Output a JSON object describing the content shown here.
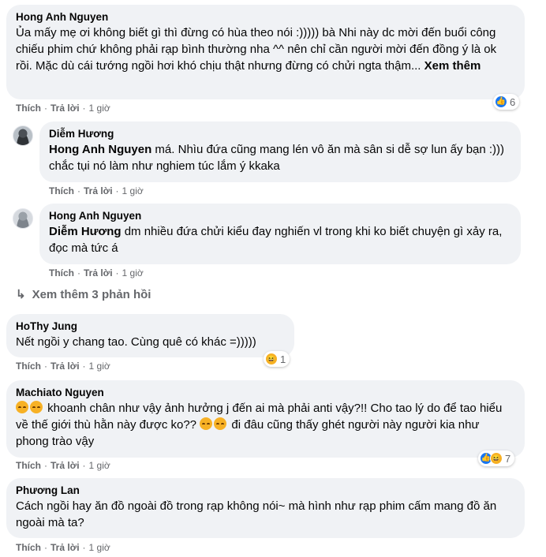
{
  "comments": [
    {
      "author": "Hong Anh Nguyen",
      "text": "Ủa mấy mẹ ơi không biết gì thì đừng có hùa theo nói :))))) bà Nhi này dc mời đến buổi công chiếu phim chứ không phải rạp bình thường nha ^^ nên chỉ cần người mời đến đồng ý là ok rồi. Mặc dù cái tướng ngồi hơi khó chịu thật nhưng đừng có chửi ngta thậm...",
      "see_more": "Xem thêm",
      "like": "Thích",
      "reply": "Trả lời",
      "time": "1 giờ",
      "reaction_count": "6"
    },
    {
      "author": "Diễm Hương",
      "mention": "Hong Anh Nguyen",
      "text": " má. Nhìu đứa cũng mang lén vô ăn mà sân si dễ sợ lun ấy bạn :))) chắc tụi nó làm như nghiem túc lắm ý kkaka",
      "like": "Thích",
      "reply": "Trả lời",
      "time": "1 giờ"
    },
    {
      "author": "Hong Anh Nguyen",
      "mention": "Diễm Hương",
      "text": " dm nhiều đứa chửi kiểu đay nghiến vl trong khi ko biết chuyện gì xảy ra, đọc mà tức á",
      "like": "Thích",
      "reply": "Trả lời",
      "time": "1 giờ"
    },
    {
      "author": "HoThy Jung",
      "text": "Nết ngồi y chang tao. Cùng quê có khác =)))))",
      "like": "Thích",
      "reply": "Trả lời",
      "time": "1 giờ",
      "reaction_count": "1"
    },
    {
      "author": "Machiato Nguyen",
      "text_a": " khoanh chân như vậy ảnh hưởng j đến ai mà phải anti vậy?!! Cho tao lý do để tao hiểu về thế giới thù hằn này được ko?? ",
      "text_b": " đi đâu cũng thấy ghét người này người kia như phong trào vậy",
      "like": "Thích",
      "reply": "Trả lời",
      "time": "1 giờ",
      "reaction_count": "7"
    },
    {
      "author": "Phương Lan",
      "text": "Cách ngồi hay ăn đồ ngoài đồ trong rạp không nói~ mà hình như rạp phim cấm mang đồ ăn ngoài mà ta?",
      "like": "Thích",
      "reply": "Trả lời",
      "time": "1 giờ"
    }
  ],
  "view_more_replies": "Xem thêm 3 phản hồi",
  "colors": {
    "bubble": "#f0f2f5",
    "meta": "#65676b",
    "like": "#1877f2",
    "haha": "#f7b125"
  }
}
